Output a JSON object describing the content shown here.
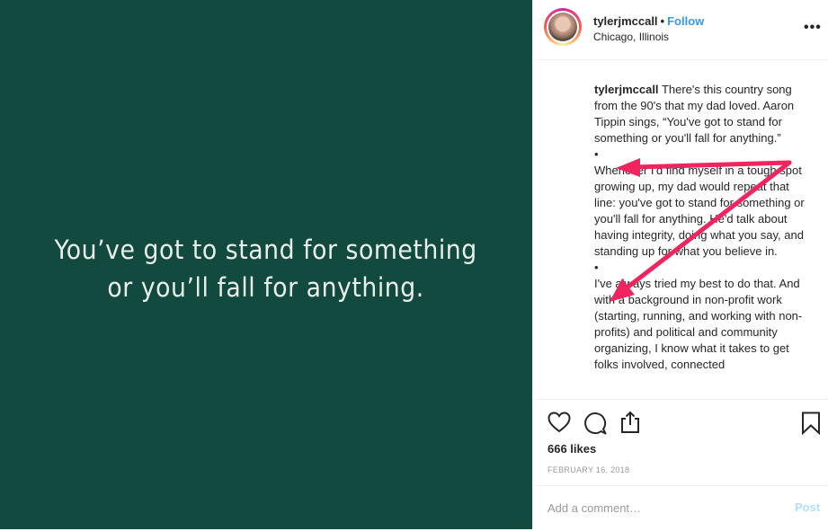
{
  "post": {
    "media_text": [
      "You’ve got to stand for something",
      "or you’ll fall for anything."
    ],
    "media_bg": "#134a3f"
  },
  "header": {
    "username": "tylerjmccall",
    "separator": "•",
    "follow_label": "Follow",
    "location": "Chicago, Illinois",
    "more_label": "•••"
  },
  "caption": {
    "username": "tylerjmccall",
    "paragraphs": [
      "There's this country song from the 90's that my dad loved. Aaron Tippin sings, “You've got to stand for something or you'll fall for anything.”",
      "•",
      "Whenever I'd find myself in a tough spot growing up, my dad would repeat that line: you've got to stand for something or you'll fall for anything. He'd talk about having integrity, doing what you say, and standing up for what you believe in.",
      "•",
      "I've always tried my best to do that. And with a background in non-profit work (starting, running, and working with non-profits) and political and community organizing, I know what it takes to get folks involved, connected"
    ]
  },
  "actions": {
    "icons": [
      "heart-icon",
      "comment-icon",
      "share-icon",
      "bookmark-icon"
    ]
  },
  "likes": "666 likes",
  "date": "FEBRUARY 16, 2018",
  "comment": {
    "placeholder": "Add a comment…",
    "post_label": "Post"
  },
  "colors": {
    "accent": "#3897f0",
    "annotation_arrow": "#f0245f"
  }
}
